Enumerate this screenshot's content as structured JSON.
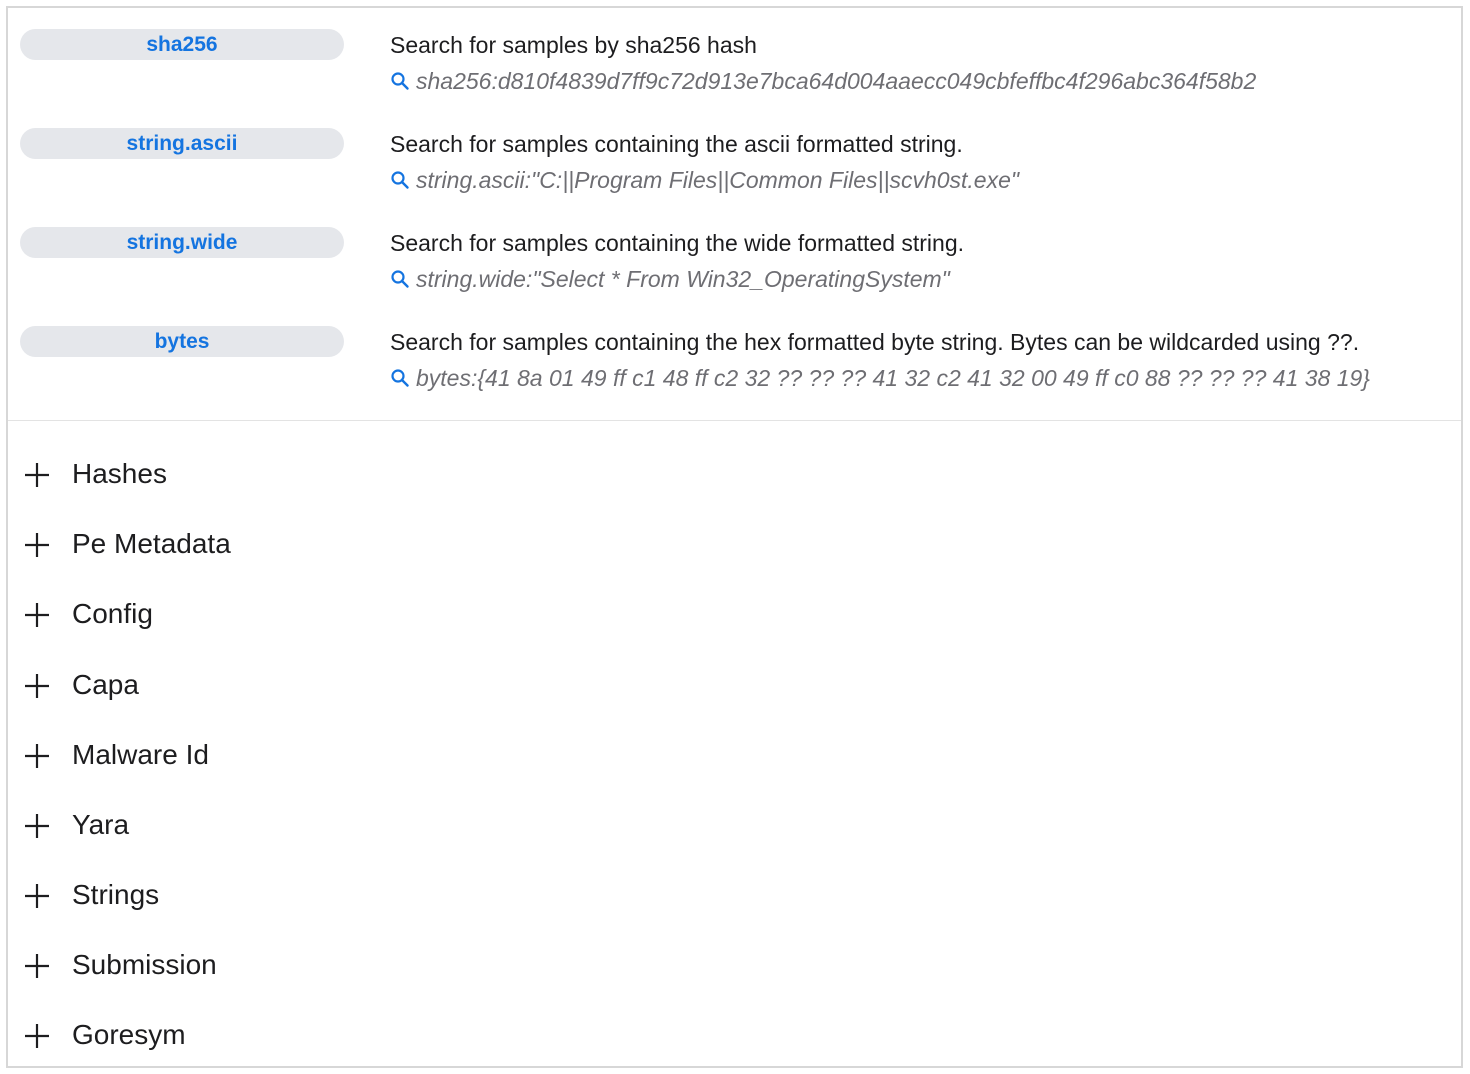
{
  "search_examples": [
    {
      "key": "sha256",
      "description": "Search for samples by sha256 hash",
      "example": "sha256:d810f4839d7ff9c72d913e7bca64d004aaecc049cbfeffbc4f296abc364f58b2"
    },
    {
      "key": "string.ascii",
      "description": "Search for samples containing the ascii formatted string.",
      "example": "string.ascii:\"C:||Program Files||Common Files||scvh0st.exe\""
    },
    {
      "key": "string.wide",
      "description": "Search for samples containing the wide formatted string.",
      "example": "string.wide:\"Select * From Win32_OperatingSystem\""
    },
    {
      "key": "bytes",
      "description": "Search for samples containing the hex formatted byte string. Bytes can be wildcarded using ??.",
      "example": "bytes:{41 8a 01 49 ff c1 48 ff c2 32 ?? ?? ?? 41 32 c2 41 32 00 49 ff c0 88 ?? ?? ?? 41 38 19}"
    }
  ],
  "sections": [
    {
      "label": "Hashes"
    },
    {
      "label": "Pe Metadata"
    },
    {
      "label": "Config"
    },
    {
      "label": "Capa"
    },
    {
      "label": "Malware Id"
    },
    {
      "label": "Yara"
    },
    {
      "label": "Strings"
    },
    {
      "label": "Submission"
    },
    {
      "label": "Goresym"
    }
  ],
  "colors": {
    "link_blue": "#1474e0",
    "pill_bg": "#e5e7eb",
    "example_gray": "#6e6e73",
    "text": "#1d1d1f"
  }
}
